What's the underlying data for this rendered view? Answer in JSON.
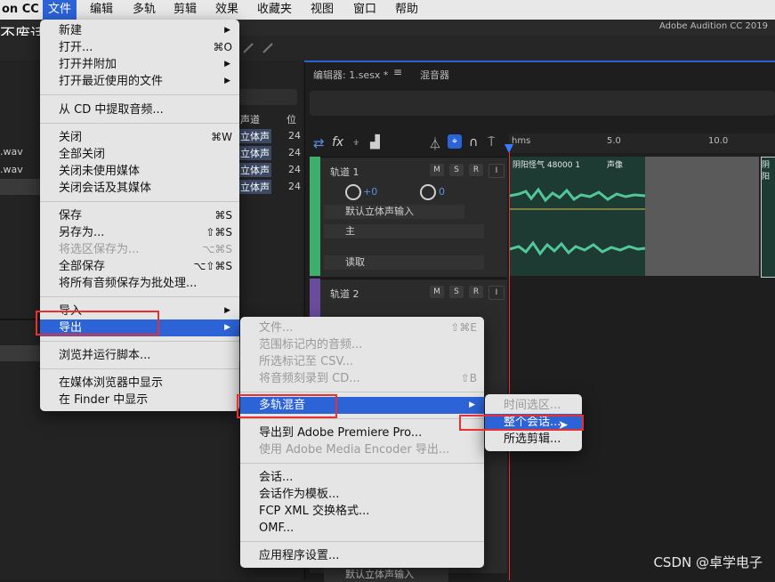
{
  "menubar": {
    "app_fragment": "on CC",
    "items": [
      "文件",
      "编辑",
      "多轨",
      "剪辑",
      "效果",
      "收藏夹",
      "视图",
      "窗口",
      "帮助"
    ]
  },
  "window_title": "Adobe Audition CC 2019",
  "overlay_title": "不废话的AU上手教程~",
  "left_panel": {
    "files": [
      ".wav",
      ".wav"
    ],
    "columns": [
      "声道",
      "位"
    ],
    "channel_cells": [
      "立体声",
      "立体声",
      "立体声",
      "立体声"
    ],
    "bit_cells": [
      "24",
      "24",
      "24",
      "24"
    ]
  },
  "editor": {
    "tab_editor": "编辑器: 1.sesx *",
    "tab_mixer": "混音器",
    "ruler_labels": [
      "hms",
      "5.0",
      "10.0"
    ],
    "track1": {
      "name": "轨道 1",
      "vol": "+0",
      "pan": "0",
      "input": "默认立体声输入",
      "output": "主",
      "mode": "读取",
      "clip_title": "阴阳怪气 48000 1",
      "clip_mode": "声像",
      "clip2_title": "阴阳"
    },
    "track2": {
      "name": "轨道 2",
      "input": "默认立体声输入"
    },
    "buttons": [
      "M",
      "S",
      "R",
      "I"
    ]
  },
  "file_menu": {
    "items": [
      {
        "label": "新建",
        "shortcut": ""
      },
      {
        "label": "打开...",
        "shortcut": "⌘O"
      },
      {
        "label": "打开并附加",
        "shortcut": ""
      },
      {
        "label": "打开最近使用的文件",
        "shortcut": ""
      },
      {
        "label": "从 CD 中提取音频...",
        "shortcut": ""
      },
      {
        "label": "关闭",
        "shortcut": "⌘W"
      },
      {
        "label": "全部关闭",
        "shortcut": ""
      },
      {
        "label": "关闭未使用媒体",
        "shortcut": ""
      },
      {
        "label": "关闭会话及其媒体",
        "shortcut": ""
      },
      {
        "label": "保存",
        "shortcut": "⌘S"
      },
      {
        "label": "另存为...",
        "shortcut": "⇧⌘S"
      },
      {
        "label": "将选区保存为...",
        "shortcut": "⌥⌘S"
      },
      {
        "label": "全部保存",
        "shortcut": "⌥⇧⌘S"
      },
      {
        "label": "将所有音频保存为批处理...",
        "shortcut": ""
      },
      {
        "label": "导入",
        "shortcut": ""
      },
      {
        "label": "导出",
        "shortcut": ""
      },
      {
        "label": "浏览并运行脚本...",
        "shortcut": ""
      },
      {
        "label": "在媒体浏览器中显示",
        "shortcut": ""
      },
      {
        "label": "在 Finder 中显示",
        "shortcut": ""
      }
    ]
  },
  "export_menu": {
    "items": [
      {
        "label": "文件...",
        "shortcut": "⇧⌘E"
      },
      {
        "label": "范围标记内的音频...",
        "shortcut": ""
      },
      {
        "label": "所选标记至 CSV...",
        "shortcut": ""
      },
      {
        "label": "将音频刻录到 CD...",
        "shortcut": "⇧B"
      },
      {
        "label": "多轨混音",
        "shortcut": ""
      },
      {
        "label": "导出到 Adobe Premiere Pro...",
        "shortcut": ""
      },
      {
        "label": "使用 Adobe Media Encoder 导出...",
        "shortcut": ""
      },
      {
        "label": "会话...",
        "shortcut": ""
      },
      {
        "label": "会话作为模板...",
        "shortcut": ""
      },
      {
        "label": "FCP XML 交换格式...",
        "shortcut": ""
      },
      {
        "label": "OMF...",
        "shortcut": ""
      },
      {
        "label": "应用程序设置...",
        "shortcut": ""
      }
    ]
  },
  "mixdown_menu": {
    "items": [
      {
        "label": "时间选区..."
      },
      {
        "label": "整个会话..."
      },
      {
        "label": "所选剪辑..."
      }
    ]
  },
  "watermark": "CSDN @卓学电子",
  "colors": {
    "highlight": "#2c63d7",
    "annotation_red": "#e8312f",
    "track1_accent": "#3fae6c",
    "track2_accent": "#6a4c9c",
    "waveform": "#52c79a"
  }
}
